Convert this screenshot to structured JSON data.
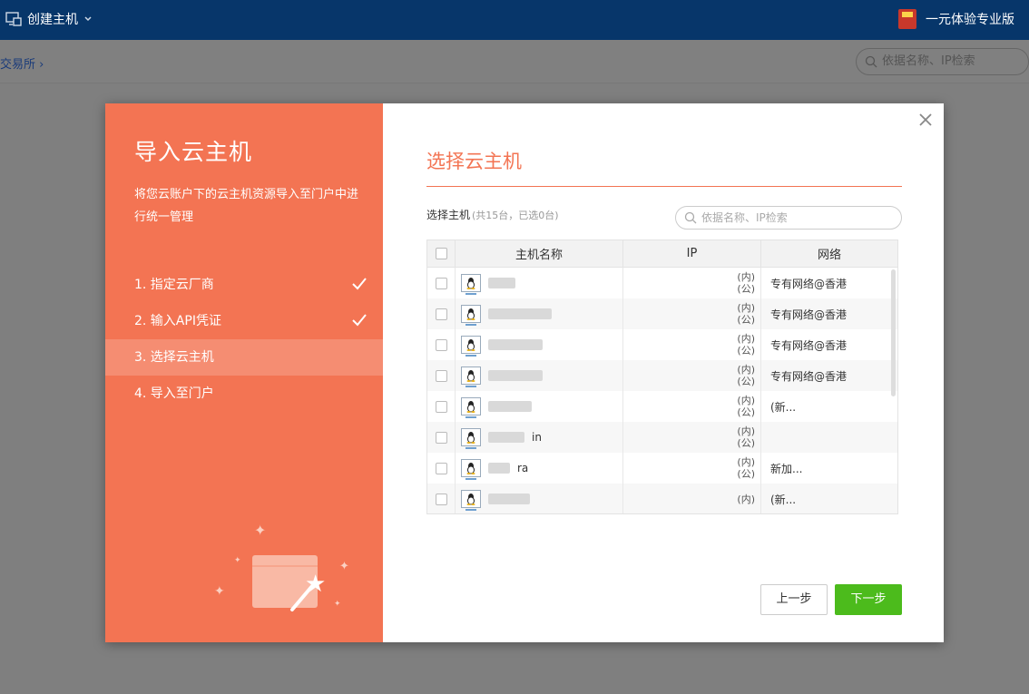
{
  "topbar": {
    "create_label": "创建主机",
    "edition_label": "一元体验专业版"
  },
  "subbar": {
    "breadcrumb": "交易所",
    "search_placeholder": "依据名称、IP检索"
  },
  "wizard": {
    "heading": "导入云主机",
    "description": "将您云账户下的云主机资源导入至门户中进行统一管理",
    "steps": [
      {
        "label": "1. 指定云厂商",
        "done": true
      },
      {
        "label": "2. 输入API凭证",
        "done": true
      },
      {
        "label": "3. 选择云主机",
        "done": false,
        "active": true
      },
      {
        "label": "4. 导入至门户",
        "done": false
      }
    ]
  },
  "panel": {
    "title": "选择云主机",
    "select_label": "选择主机",
    "select_count": "(共15台，已选0台)",
    "search_placeholder": "依据名称、IP检索",
    "columns": {
      "name": "主机名称",
      "ip": "IP",
      "network": "网络"
    },
    "rows": [
      {
        "name": "",
        "ip_a": "(内)",
        "ip_b": "(公)",
        "network": "专有网络@香港"
      },
      {
        "name": "",
        "ip_a": "(内)",
        "ip_b": "(公)",
        "network": "专有网络@香港"
      },
      {
        "name": "",
        "ip_a": "(内)",
        "ip_b": "(公)",
        "network": "专有网络@香港"
      },
      {
        "name": "",
        "ip_a": "(内)",
        "ip_b": "(公)",
        "network": "专有网络@香港"
      },
      {
        "name": "",
        "ip_a": "(内)",
        "ip_b": "(公)",
        "network": "(新..."
      },
      {
        "name": "in",
        "ip_a": "(内)",
        "ip_b": "(公)",
        "network": ""
      },
      {
        "name": "ra",
        "ip_a": "(内)",
        "ip_b": "(公)",
        "network": "新加..."
      },
      {
        "name": "",
        "ip_a": "(内)",
        "ip_b": "",
        "network": "(新..."
      }
    ],
    "prev_label": "上一步",
    "next_label": "下一步"
  },
  "colors": {
    "accent": "#f37453",
    "topbar": "#07366a",
    "next_button": "#4cbb1c"
  }
}
